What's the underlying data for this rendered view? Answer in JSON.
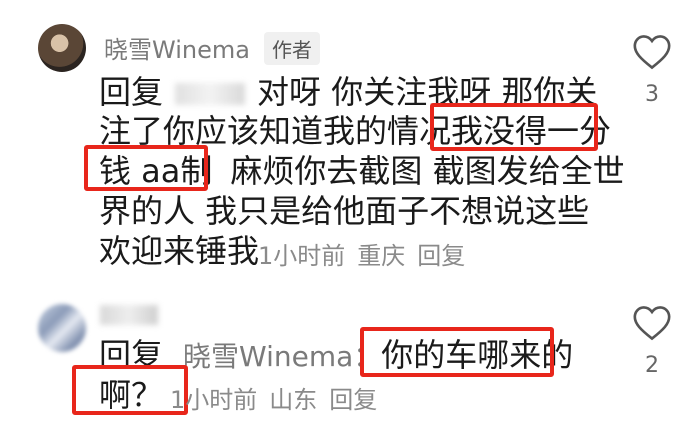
{
  "comments": [
    {
      "user": "晓雪Winema",
      "badge": "作者",
      "lines": [
        [
          "回复",
          "对呀 你关注我呀 那你关"
        ],
        [
          "注了你应该知道我的情况",
          "我没得一分"
        ],
        [
          "钱 aa制",
          "麻烦你去截图 截图发给全世"
        ],
        [
          "界的人 我只是给他面子不想说这些"
        ],
        [
          "欢迎来锤我"
        ]
      ],
      "meta": {
        "time": "1小时前",
        "location": "重庆",
        "reply": "回复"
      },
      "likes": "3"
    },
    {
      "reply_prefix": "回复",
      "reply_to": "晓雪Winema：",
      "line1_highlight": "你的车哪来的",
      "line2_highlight": "啊？",
      "meta": {
        "time": "1小时前",
        "location": "山东",
        "reply": "回复"
      },
      "likes": "2"
    }
  ]
}
